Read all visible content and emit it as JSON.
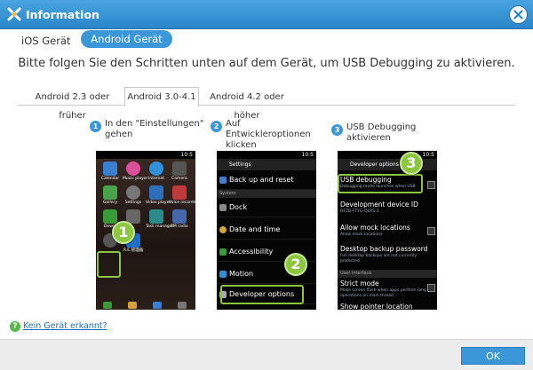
{
  "window": {
    "title": "Information"
  },
  "device_tabs": {
    "ios": "iOS Gerät",
    "android": "Android Gerät"
  },
  "instruction": "Bitte folgen Sie den Schritten unten auf dem Gerät, um USB Debugging zu aktivieren.",
  "version_tabs": [
    "Android 2.3 oder früher",
    "Android 3.0-4.1",
    "Android 4.2 oder höher"
  ],
  "active_version_tab": 1,
  "steps": [
    {
      "num": "1",
      "line1": "In den \"Einstellungen\"",
      "line2": "gehen"
    },
    {
      "num": "2",
      "line1": "Auf Entwickleroptionen",
      "line2": "klicken"
    },
    {
      "num": "3",
      "line1": "USB Debugging aktivieren",
      "line2": ""
    }
  ],
  "phone1": {
    "time": "10:5",
    "apps": [
      "Calendar",
      "Music player",
      "Internet",
      "Camera",
      "Gallery",
      "Settings",
      "Video player",
      "Voice recorder",
      "Downl",
      "",
      "Task manager",
      "FM radio",
      "",
      "R.E.管理器",
      "",
      ""
    ]
  },
  "phone2": {
    "time": "10:5",
    "title": "Settings",
    "rows": [
      "Back up and reset",
      "Dock",
      "Date and time",
      "Accessibility",
      "Motion",
      "Developer options"
    ],
    "section": "System"
  },
  "phone3": {
    "time": "10:5",
    "title": "Developer options",
    "items": [
      {
        "title": "USB debugging",
        "sub": "Debugging mode launches when USB"
      },
      {
        "title": "Development device ID",
        "sub": "DFZB-FTYG-QLRS-2"
      },
      {
        "title": "Allow mock locations",
        "sub": "Allow mock locations"
      },
      {
        "title": "Desktop backup password",
        "sub": "Full desktop backups are not currently protected"
      },
      {
        "title": "Strict mode",
        "sub": "Make screen flash when apps perform long operations on main thread"
      },
      {
        "title": "Show pointer location",
        "sub": ""
      }
    ],
    "section": "User interface"
  },
  "badges": [
    "1",
    "2",
    "3"
  ],
  "footer": {
    "help_icon": "?",
    "help_link": "Kein Gerät erkannt?",
    "ok": "OK"
  },
  "colors": {
    "title_bar": "#2a86c9",
    "accent": "#3c97d9",
    "highlight": "#8cc63f",
    "help": "#55b848"
  },
  "icons": [
    "app-logo-icon",
    "close-icon",
    "step-number-icon",
    "help-icon"
  ]
}
